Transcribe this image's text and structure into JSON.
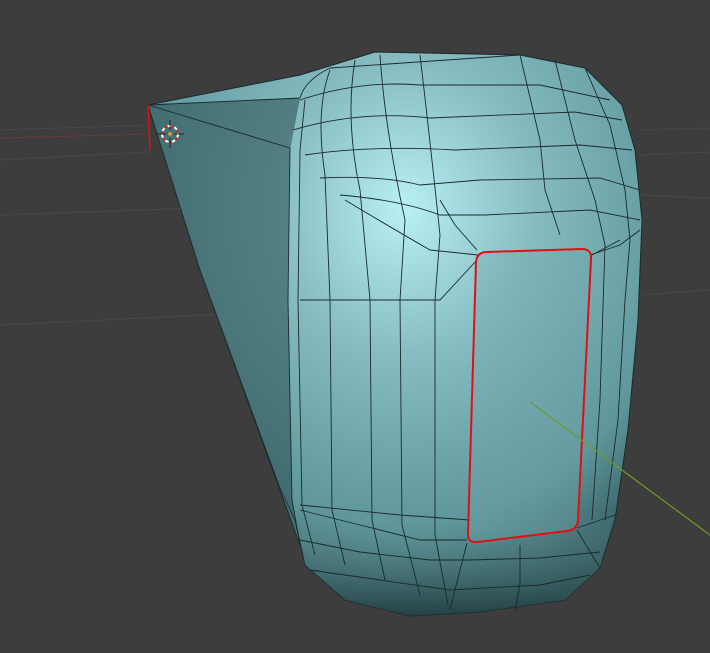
{
  "viewport": {
    "background_color": "#3d3d3d",
    "grid_color": "#4a4a4a",
    "mesh_color": "#7fb3b8",
    "mesh_shadow_color": "#234448",
    "mesh_highlight_color": "#b8f0f5",
    "wire_color": "#1a2a2c",
    "selection_color": "#e01010",
    "y_axis_color": "#6f9a2c",
    "cursor_icon": "3d-cursor-icon"
  }
}
